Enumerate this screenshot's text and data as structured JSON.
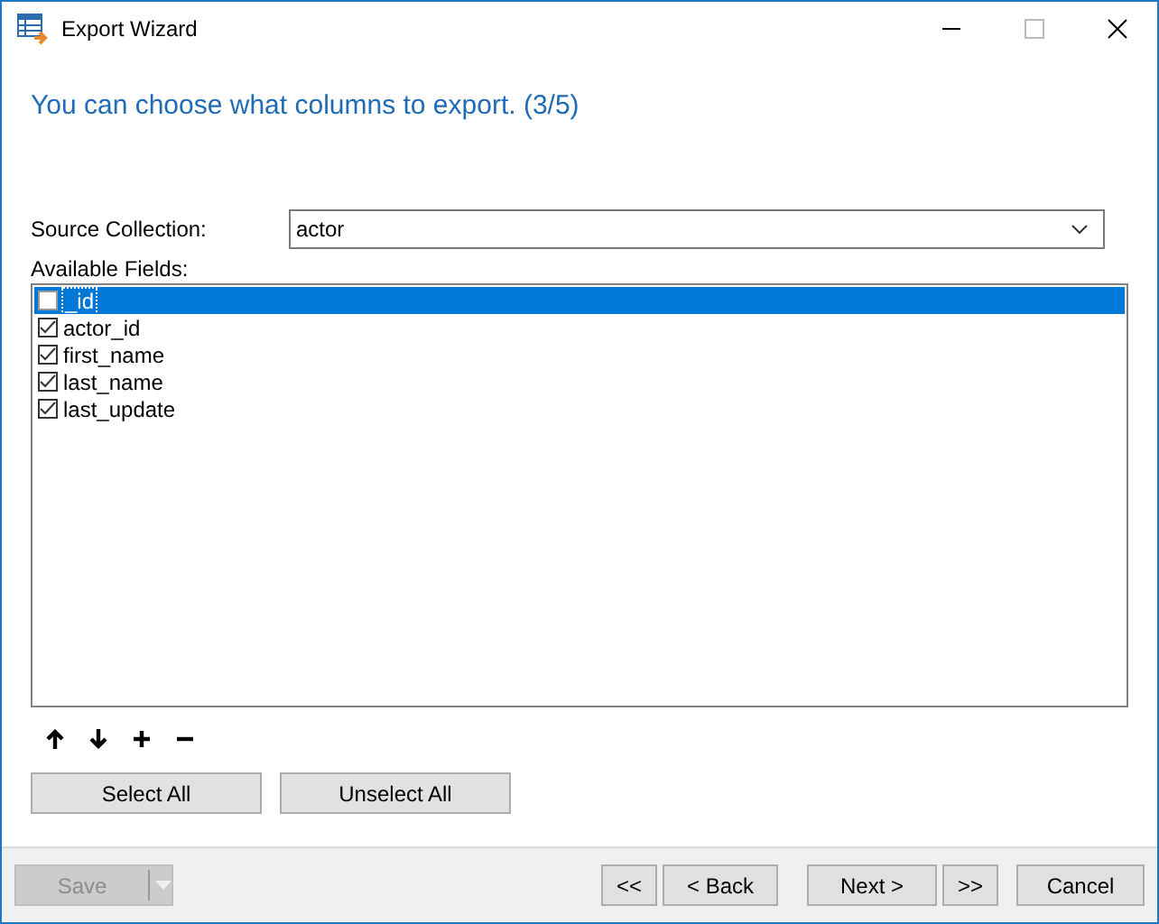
{
  "window": {
    "title": "Export Wizard"
  },
  "heading": "You can choose what columns to export. (3/5)",
  "source": {
    "label": "Source Collection:",
    "value": "actor"
  },
  "fields_label": "Available Fields:",
  "fields": [
    {
      "name": "_id",
      "checked": false,
      "selected": true
    },
    {
      "name": "actor_id",
      "checked": true,
      "selected": false
    },
    {
      "name": "first_name",
      "checked": true,
      "selected": false
    },
    {
      "name": "last_name",
      "checked": true,
      "selected": false
    },
    {
      "name": "last_update",
      "checked": true,
      "selected": false
    }
  ],
  "tools": [
    {
      "kind": "up"
    },
    {
      "kind": "down"
    },
    {
      "kind": "add"
    },
    {
      "kind": "remove"
    }
  ],
  "select_buttons": [
    "Select All",
    "Unselect All"
  ],
  "save": {
    "label": "Save",
    "disabled": true
  },
  "nav_buttons": [
    "<<",
    "< Back",
    "Next >",
    ">>",
    "Cancel"
  ]
}
